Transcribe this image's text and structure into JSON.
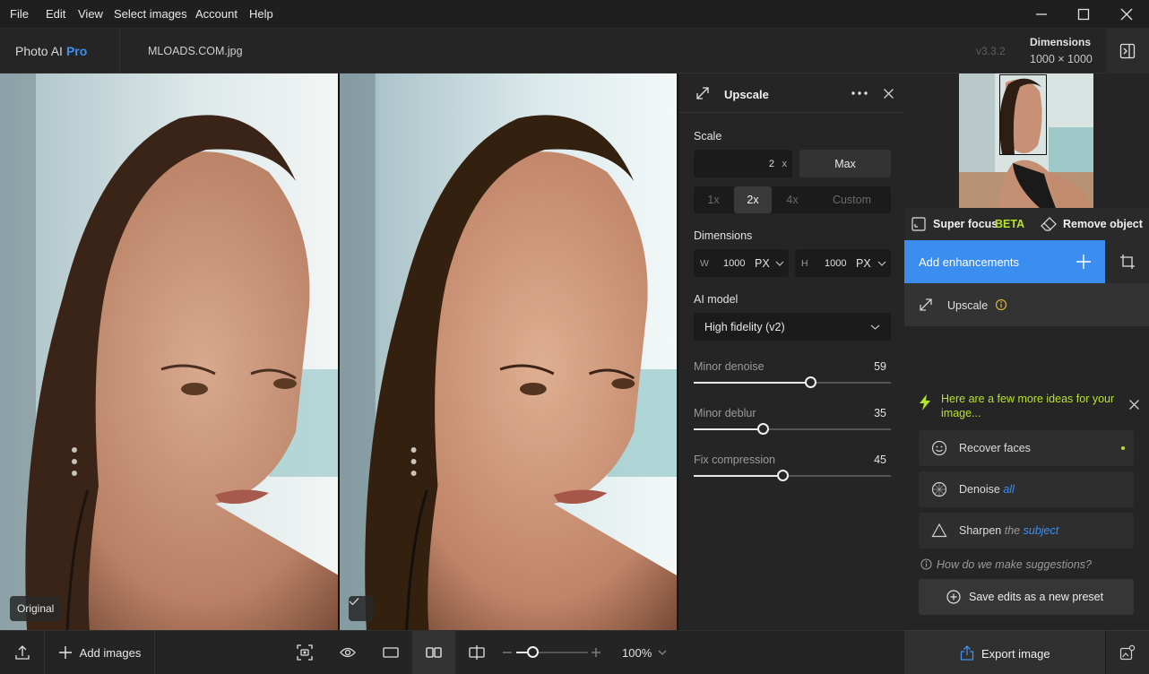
{
  "menu": {
    "file": "File",
    "edit": "Edit",
    "view": "View",
    "select_images": "Select images",
    "account": "Account",
    "help": "Help"
  },
  "header": {
    "app_name": "Photo AI",
    "app_tier": "Pro",
    "filename": "MLOADS.COM.jpg",
    "version": "v3.3.2",
    "dimensions_label": "Dimensions",
    "dimensions_value": "1000 × 1000"
  },
  "viewer": {
    "original_label": "Original"
  },
  "bottombar": {
    "add_images": "Add images",
    "zoom": "100%",
    "zoom_fraction": 0.23
  },
  "upscale_panel": {
    "title": "Upscale",
    "scale_label": "Scale",
    "scale_value": "2",
    "scale_unit": "x",
    "max_label": "Max",
    "presets": [
      "1x",
      "2x",
      "4x",
      "Custom"
    ],
    "selected_preset": "2x",
    "dimensions_label": "Dimensions",
    "width_label": "W",
    "width_value": "1000",
    "height_label": "H",
    "height_value": "1000",
    "unit": "PX",
    "ai_model_label": "AI model",
    "ai_model_value": "High fidelity (v2)",
    "sliders": [
      {
        "label": "Minor denoise",
        "value": "59",
        "fraction": 0.59
      },
      {
        "label": "Minor deblur",
        "value": "35",
        "fraction": 0.35
      },
      {
        "label": "Fix compression",
        "value": "45",
        "fraction": 0.45
      }
    ]
  },
  "right_panel": {
    "super_focus": "Super focus",
    "beta": "BETA",
    "remove_object": "Remove object",
    "add_enhancements": "Add enhancements",
    "upscale_item": "Upscale",
    "ideas_title": "Here are a few more ideas for your image...",
    "ideas": {
      "recover_faces": "Recover faces",
      "denoise": "Denoise",
      "denoise_scope": "all",
      "sharpen": "Sharpen",
      "sharpen_the": "the",
      "sharpen_scope": "subject"
    },
    "suggestions_link": "How do we make suggestions?",
    "save_preset": "Save edits as a new preset",
    "export": "Export image"
  },
  "colors": {
    "accent_blue": "#3d8ff0",
    "highlight_green": "#b6e32b",
    "warning_yellow": "#d7b23a"
  }
}
